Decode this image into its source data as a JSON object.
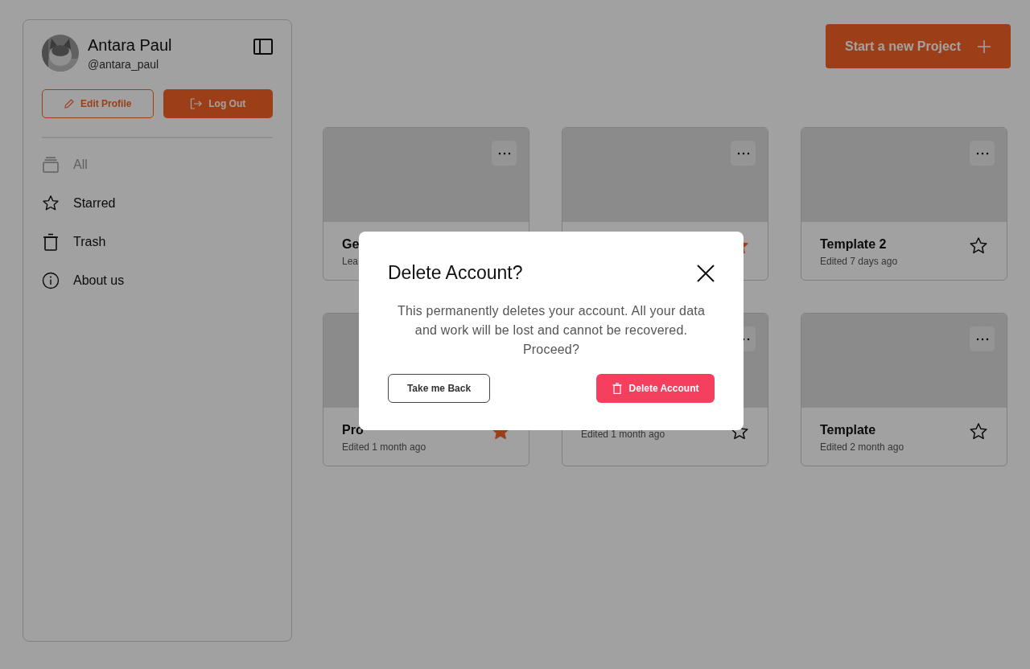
{
  "sidebar": {
    "user": {
      "name": "Antara Paul",
      "handle": "@antara_paul"
    },
    "buttons": [
      {
        "label": "Edit Profile",
        "kind": "outline"
      },
      {
        "label": "Log Out",
        "kind": "filled"
      }
    ],
    "items": [
      {
        "label": "All",
        "selected": true
      },
      {
        "label": "Starred",
        "selected": false
      },
      {
        "label": "Trash",
        "selected": false
      },
      {
        "label": "About us",
        "selected": false
      }
    ]
  },
  "new_project_button": {
    "label": "Start a new Project"
  },
  "cards": [
    {
      "title": "Ge",
      "subtitle": "Lea",
      "menu": true
    },
    {
      "menu": true,
      "starred": true
    },
    {
      "title": "Template 2",
      "subtitle": "Edited 7 days ago",
      "menu": true,
      "starred": false
    },
    {
      "title": "Pro",
      "subtitle": "Edited 1 month ago",
      "menu": false,
      "starred": true
    },
    {
      "subtitle": "Edited 1 month ago",
      "menu": true,
      "starred": false
    },
    {
      "title": "Template",
      "subtitle": "Edited 2 month ago",
      "menu": true,
      "starred": false
    }
  ],
  "dialog": {
    "title": "Delete Account?",
    "message": "This permanently deletes your account. All your data and work will be lost and cannot be recovered. Proceed?",
    "buttons": [
      {
        "label": "Take me Back",
        "kind": "secondary"
      },
      {
        "label": "Delete Account",
        "kind": "danger"
      }
    ]
  }
}
